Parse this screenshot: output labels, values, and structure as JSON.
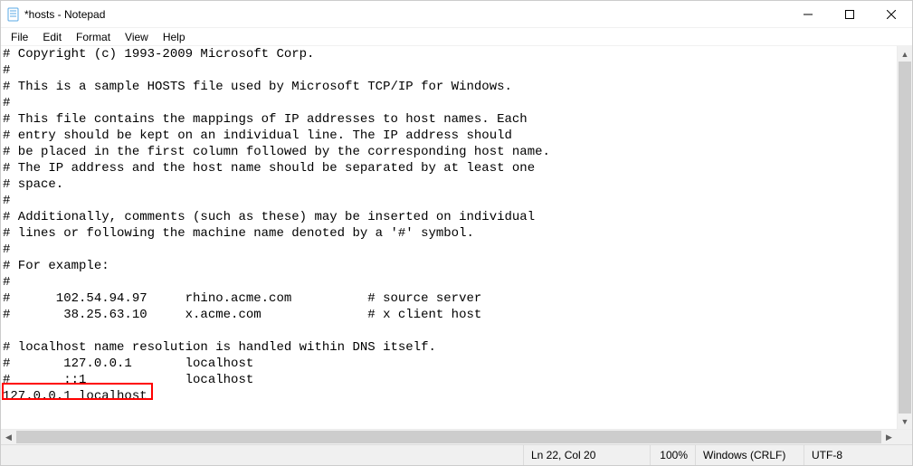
{
  "window": {
    "title": "*hosts - Notepad"
  },
  "menu": {
    "file": "File",
    "edit": "Edit",
    "format": "Format",
    "view": "View",
    "help": "Help"
  },
  "editor": {
    "content": "# Copyright (c) 1993-2009 Microsoft Corp.\n#\n# This is a sample HOSTS file used by Microsoft TCP/IP for Windows.\n#\n# This file contains the mappings of IP addresses to host names. Each\n# entry should be kept on an individual line. The IP address should\n# be placed in the first column followed by the corresponding host name.\n# The IP address and the host name should be separated by at least one\n# space.\n#\n# Additionally, comments (such as these) may be inserted on individual\n# lines or following the machine name denoted by a '#' symbol.\n#\n# For example:\n#\n#      102.54.94.97     rhino.acme.com          # source server\n#       38.25.63.10     x.acme.com              # x client host\n\n# localhost name resolution is handled within DNS itself.\n#       127.0.0.1       localhost\n#       ::1             localhost\n127.0.0.1 localhost"
  },
  "status": {
    "position": "Ln 22, Col 20",
    "zoom": "100%",
    "line_ending": "Windows (CRLF)",
    "encoding": "UTF-8"
  }
}
